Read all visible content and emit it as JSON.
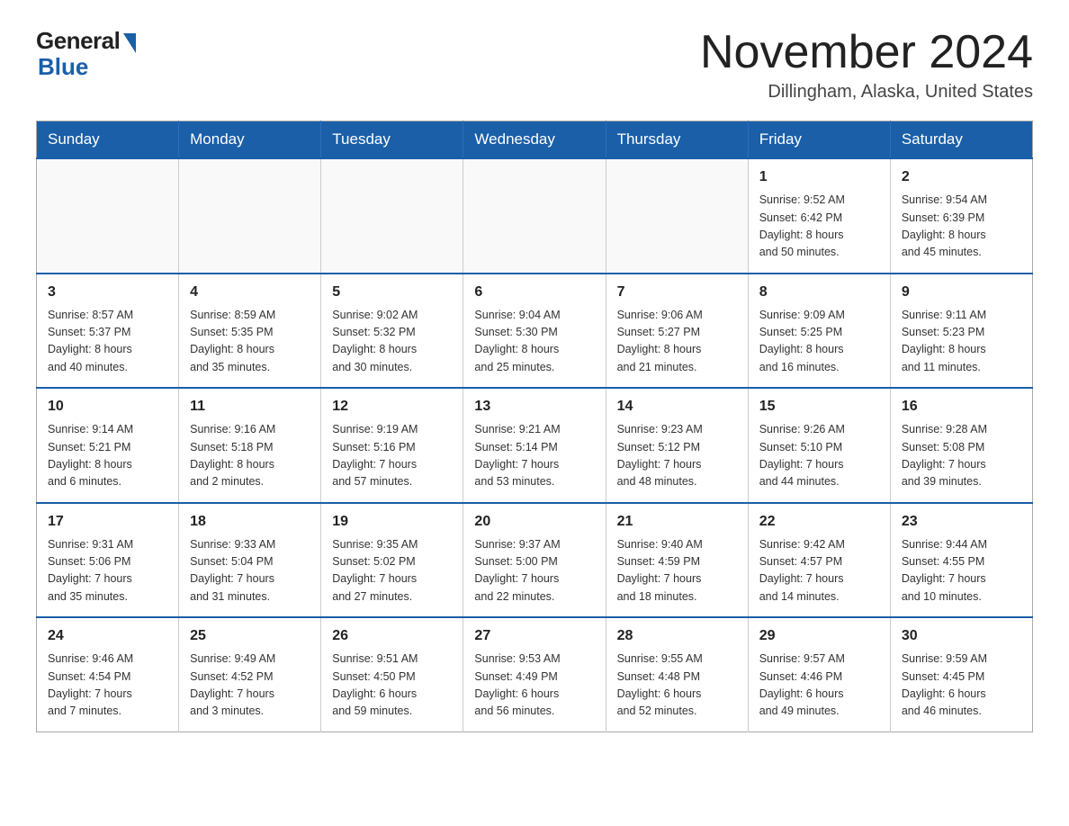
{
  "header": {
    "logo_general": "General",
    "logo_blue": "Blue",
    "month_title": "November 2024",
    "location": "Dillingham, Alaska, United States"
  },
  "weekdays": [
    "Sunday",
    "Monday",
    "Tuesday",
    "Wednesday",
    "Thursday",
    "Friday",
    "Saturday"
  ],
  "weeks": [
    [
      {
        "day": "",
        "info": ""
      },
      {
        "day": "",
        "info": ""
      },
      {
        "day": "",
        "info": ""
      },
      {
        "day": "",
        "info": ""
      },
      {
        "day": "",
        "info": ""
      },
      {
        "day": "1",
        "info": "Sunrise: 9:52 AM\nSunset: 6:42 PM\nDaylight: 8 hours\nand 50 minutes."
      },
      {
        "day": "2",
        "info": "Sunrise: 9:54 AM\nSunset: 6:39 PM\nDaylight: 8 hours\nand 45 minutes."
      }
    ],
    [
      {
        "day": "3",
        "info": "Sunrise: 8:57 AM\nSunset: 5:37 PM\nDaylight: 8 hours\nand 40 minutes."
      },
      {
        "day": "4",
        "info": "Sunrise: 8:59 AM\nSunset: 5:35 PM\nDaylight: 8 hours\nand 35 minutes."
      },
      {
        "day": "5",
        "info": "Sunrise: 9:02 AM\nSunset: 5:32 PM\nDaylight: 8 hours\nand 30 minutes."
      },
      {
        "day": "6",
        "info": "Sunrise: 9:04 AM\nSunset: 5:30 PM\nDaylight: 8 hours\nand 25 minutes."
      },
      {
        "day": "7",
        "info": "Sunrise: 9:06 AM\nSunset: 5:27 PM\nDaylight: 8 hours\nand 21 minutes."
      },
      {
        "day": "8",
        "info": "Sunrise: 9:09 AM\nSunset: 5:25 PM\nDaylight: 8 hours\nand 16 minutes."
      },
      {
        "day": "9",
        "info": "Sunrise: 9:11 AM\nSunset: 5:23 PM\nDaylight: 8 hours\nand 11 minutes."
      }
    ],
    [
      {
        "day": "10",
        "info": "Sunrise: 9:14 AM\nSunset: 5:21 PM\nDaylight: 8 hours\nand 6 minutes."
      },
      {
        "day": "11",
        "info": "Sunrise: 9:16 AM\nSunset: 5:18 PM\nDaylight: 8 hours\nand 2 minutes."
      },
      {
        "day": "12",
        "info": "Sunrise: 9:19 AM\nSunset: 5:16 PM\nDaylight: 7 hours\nand 57 minutes."
      },
      {
        "day": "13",
        "info": "Sunrise: 9:21 AM\nSunset: 5:14 PM\nDaylight: 7 hours\nand 53 minutes."
      },
      {
        "day": "14",
        "info": "Sunrise: 9:23 AM\nSunset: 5:12 PM\nDaylight: 7 hours\nand 48 minutes."
      },
      {
        "day": "15",
        "info": "Sunrise: 9:26 AM\nSunset: 5:10 PM\nDaylight: 7 hours\nand 44 minutes."
      },
      {
        "day": "16",
        "info": "Sunrise: 9:28 AM\nSunset: 5:08 PM\nDaylight: 7 hours\nand 39 minutes."
      }
    ],
    [
      {
        "day": "17",
        "info": "Sunrise: 9:31 AM\nSunset: 5:06 PM\nDaylight: 7 hours\nand 35 minutes."
      },
      {
        "day": "18",
        "info": "Sunrise: 9:33 AM\nSunset: 5:04 PM\nDaylight: 7 hours\nand 31 minutes."
      },
      {
        "day": "19",
        "info": "Sunrise: 9:35 AM\nSunset: 5:02 PM\nDaylight: 7 hours\nand 27 minutes."
      },
      {
        "day": "20",
        "info": "Sunrise: 9:37 AM\nSunset: 5:00 PM\nDaylight: 7 hours\nand 22 minutes."
      },
      {
        "day": "21",
        "info": "Sunrise: 9:40 AM\nSunset: 4:59 PM\nDaylight: 7 hours\nand 18 minutes."
      },
      {
        "day": "22",
        "info": "Sunrise: 9:42 AM\nSunset: 4:57 PM\nDaylight: 7 hours\nand 14 minutes."
      },
      {
        "day": "23",
        "info": "Sunrise: 9:44 AM\nSunset: 4:55 PM\nDaylight: 7 hours\nand 10 minutes."
      }
    ],
    [
      {
        "day": "24",
        "info": "Sunrise: 9:46 AM\nSunset: 4:54 PM\nDaylight: 7 hours\nand 7 minutes."
      },
      {
        "day": "25",
        "info": "Sunrise: 9:49 AM\nSunset: 4:52 PM\nDaylight: 7 hours\nand 3 minutes."
      },
      {
        "day": "26",
        "info": "Sunrise: 9:51 AM\nSunset: 4:50 PM\nDaylight: 6 hours\nand 59 minutes."
      },
      {
        "day": "27",
        "info": "Sunrise: 9:53 AM\nSunset: 4:49 PM\nDaylight: 6 hours\nand 56 minutes."
      },
      {
        "day": "28",
        "info": "Sunrise: 9:55 AM\nSunset: 4:48 PM\nDaylight: 6 hours\nand 52 minutes."
      },
      {
        "day": "29",
        "info": "Sunrise: 9:57 AM\nSunset: 4:46 PM\nDaylight: 6 hours\nand 49 minutes."
      },
      {
        "day": "30",
        "info": "Sunrise: 9:59 AM\nSunset: 4:45 PM\nDaylight: 6 hours\nand 46 minutes."
      }
    ]
  ]
}
